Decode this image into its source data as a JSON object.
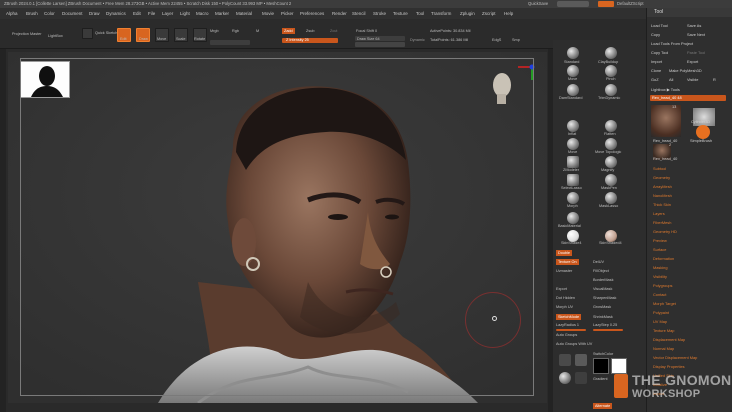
{
  "titlebar": {
    "title": "ZBrush 2024.0.1 [Collette Larsen]   ZBrush Document   • Free Mem 28.273GB • Active Mem 22455 • Scratch Disk 150 • PolyCount 33.993 MP • MeshCount 2",
    "quicksave": "QuickSave",
    "menus_label": "Menus",
    "default_script": "DefaultZScript"
  },
  "menubar": [
    "Alpha",
    "Brush",
    "Color",
    "Document",
    "Draw",
    "Dynamics",
    "Edit",
    "File",
    "Layer",
    "Light",
    "Macro",
    "Marker",
    "Material",
    "Movie",
    "Picker",
    "Preferences",
    "Render",
    "Stencil",
    "Stroke",
    "Texture",
    "Tool",
    "Transform",
    "Zplugin",
    "Zscript",
    "Help"
  ],
  "shelf": {
    "projection_master": "Projection Master",
    "lightbox": "LightBox",
    "quick_sketch": "Quick Sketch",
    "edit": "Edit",
    "draw": "Draw",
    "move": "Move",
    "scale": "Scale",
    "rotate": "Rotate",
    "mrgb": "Mrgb",
    "rgb": "Rgb",
    "m": "M",
    "zadd": "Zadd",
    "zsub": "Zsub",
    "zcut": "Zcut",
    "z_intensity": "Z Intensity 25",
    "focal_shift": "Focal Shift 0",
    "draw_size": "Draw Size 64",
    "dynamic": "Dynamic",
    "active_points": "ActivePoints: 30.834 Mil",
    "total_points": "TotalPoints: 61.386 Mil",
    "edg": "EdgS",
    "smp": "Smp"
  },
  "brushes": {
    "items": [
      "Standard",
      "ClayBuildup",
      "Move",
      "Pinch",
      "DamStandard",
      "TrimDynamic",
      "Inflat",
      "Flatten",
      "Move",
      "Move Topologic",
      "ZModeler",
      "Magnify",
      "SelectLasso",
      "MaskPen",
      "Morph",
      "MaskLasso",
      "BasicMaterial",
      "",
      "SkinShade4",
      "SkinShaded4"
    ],
    "double": "Double",
    "texture_on": "Texture On",
    "del_uv": "DelUV",
    "uv_label": "Uvmaster",
    "fill_object": "FillObject",
    "bio_mask": "BorderMask",
    "export": "Export",
    "vis_mask": "VisualMask",
    "dot_hidden": "Dot Hidden",
    "sharpen_mask": "SharpenMask",
    "morph_uv": "Morph UV",
    "grow_mask": "GrowMask",
    "sketch_mode": "SketchMode",
    "shrink_mask": "ShrinkMask",
    "lazy_radius": "LazyRadius 1",
    "lazy_step": "LazyStep 0.25",
    "auto_groups": "Auto Groups",
    "auto_groups_uv": "Auto Groups With UV",
    "switch_color": "SwitchColor",
    "gradient": "Gradient",
    "alternate": "Alternate"
  },
  "tool": {
    "title": "Tool",
    "load_tool": "Load Tool",
    "save_as": "Save As",
    "copy": "Copy",
    "save_next": "Save Next",
    "load_from_project": "Load Tools From Project",
    "copy_tool": "Copy Tool",
    "paste_tool": "Paste Tool",
    "import": "Import",
    "export": "Export",
    "clone": "Clone",
    "make_polymesh": "Make PolyMesh3D",
    "goz": "GoZ",
    "all": "All",
    "visible": "Visible",
    "r": "R",
    "lightbox_tools": "Lightbox ▶ Tools",
    "current": "Rex_head_40  48",
    "slider_value": "R",
    "thumb_labels": [
      "Rex_head_40",
      "Cylinder3D",
      "SimpleBrush",
      "Rex_head_40",
      "PM3D_Rex"
    ],
    "counts": [
      "13",
      "2"
    ],
    "sections": [
      "Subtool",
      "Geometry",
      "ArrayMesh",
      "NanoMesh",
      "Thick Skin",
      "Layers",
      "FiberMesh",
      "Geometry HD",
      "Preview",
      "Surface",
      "Deformation",
      "Masking",
      "Visibility",
      "Polygroups",
      "Contact",
      "Morph Target",
      "Polypaint",
      "UV Map",
      "Texture Map",
      "Displacement Map",
      "Normal Map",
      "Vector Displacement Map",
      "Display Properties",
      "Unified Skin",
      "Initialize",
      "Import"
    ],
    "sections_orange": [
      "Subtool",
      "Geometry",
      "ArrayMesh",
      "NanoMesh",
      "Thick Skin",
      "Layers",
      "FiberMesh",
      "Geometry HD",
      "Preview",
      "Surface",
      "Deformation",
      "Masking",
      "Visibility",
      "Polygroups",
      "Contact",
      "Morph Target",
      "Polypaint",
      "UV Map",
      "Texture Map",
      "Displacement Map",
      "Normal Map",
      "Vector Displacement Map",
      "Display Properties",
      "Unified Skin",
      "Initialize",
      "Import"
    ]
  },
  "watermark": {
    "line1": "THE GNOMON",
    "line2": "WORKSHOP"
  },
  "colors": {
    "accent": "#d86520",
    "panel": "#2d2d2d",
    "viewport_bg": "#353535"
  }
}
